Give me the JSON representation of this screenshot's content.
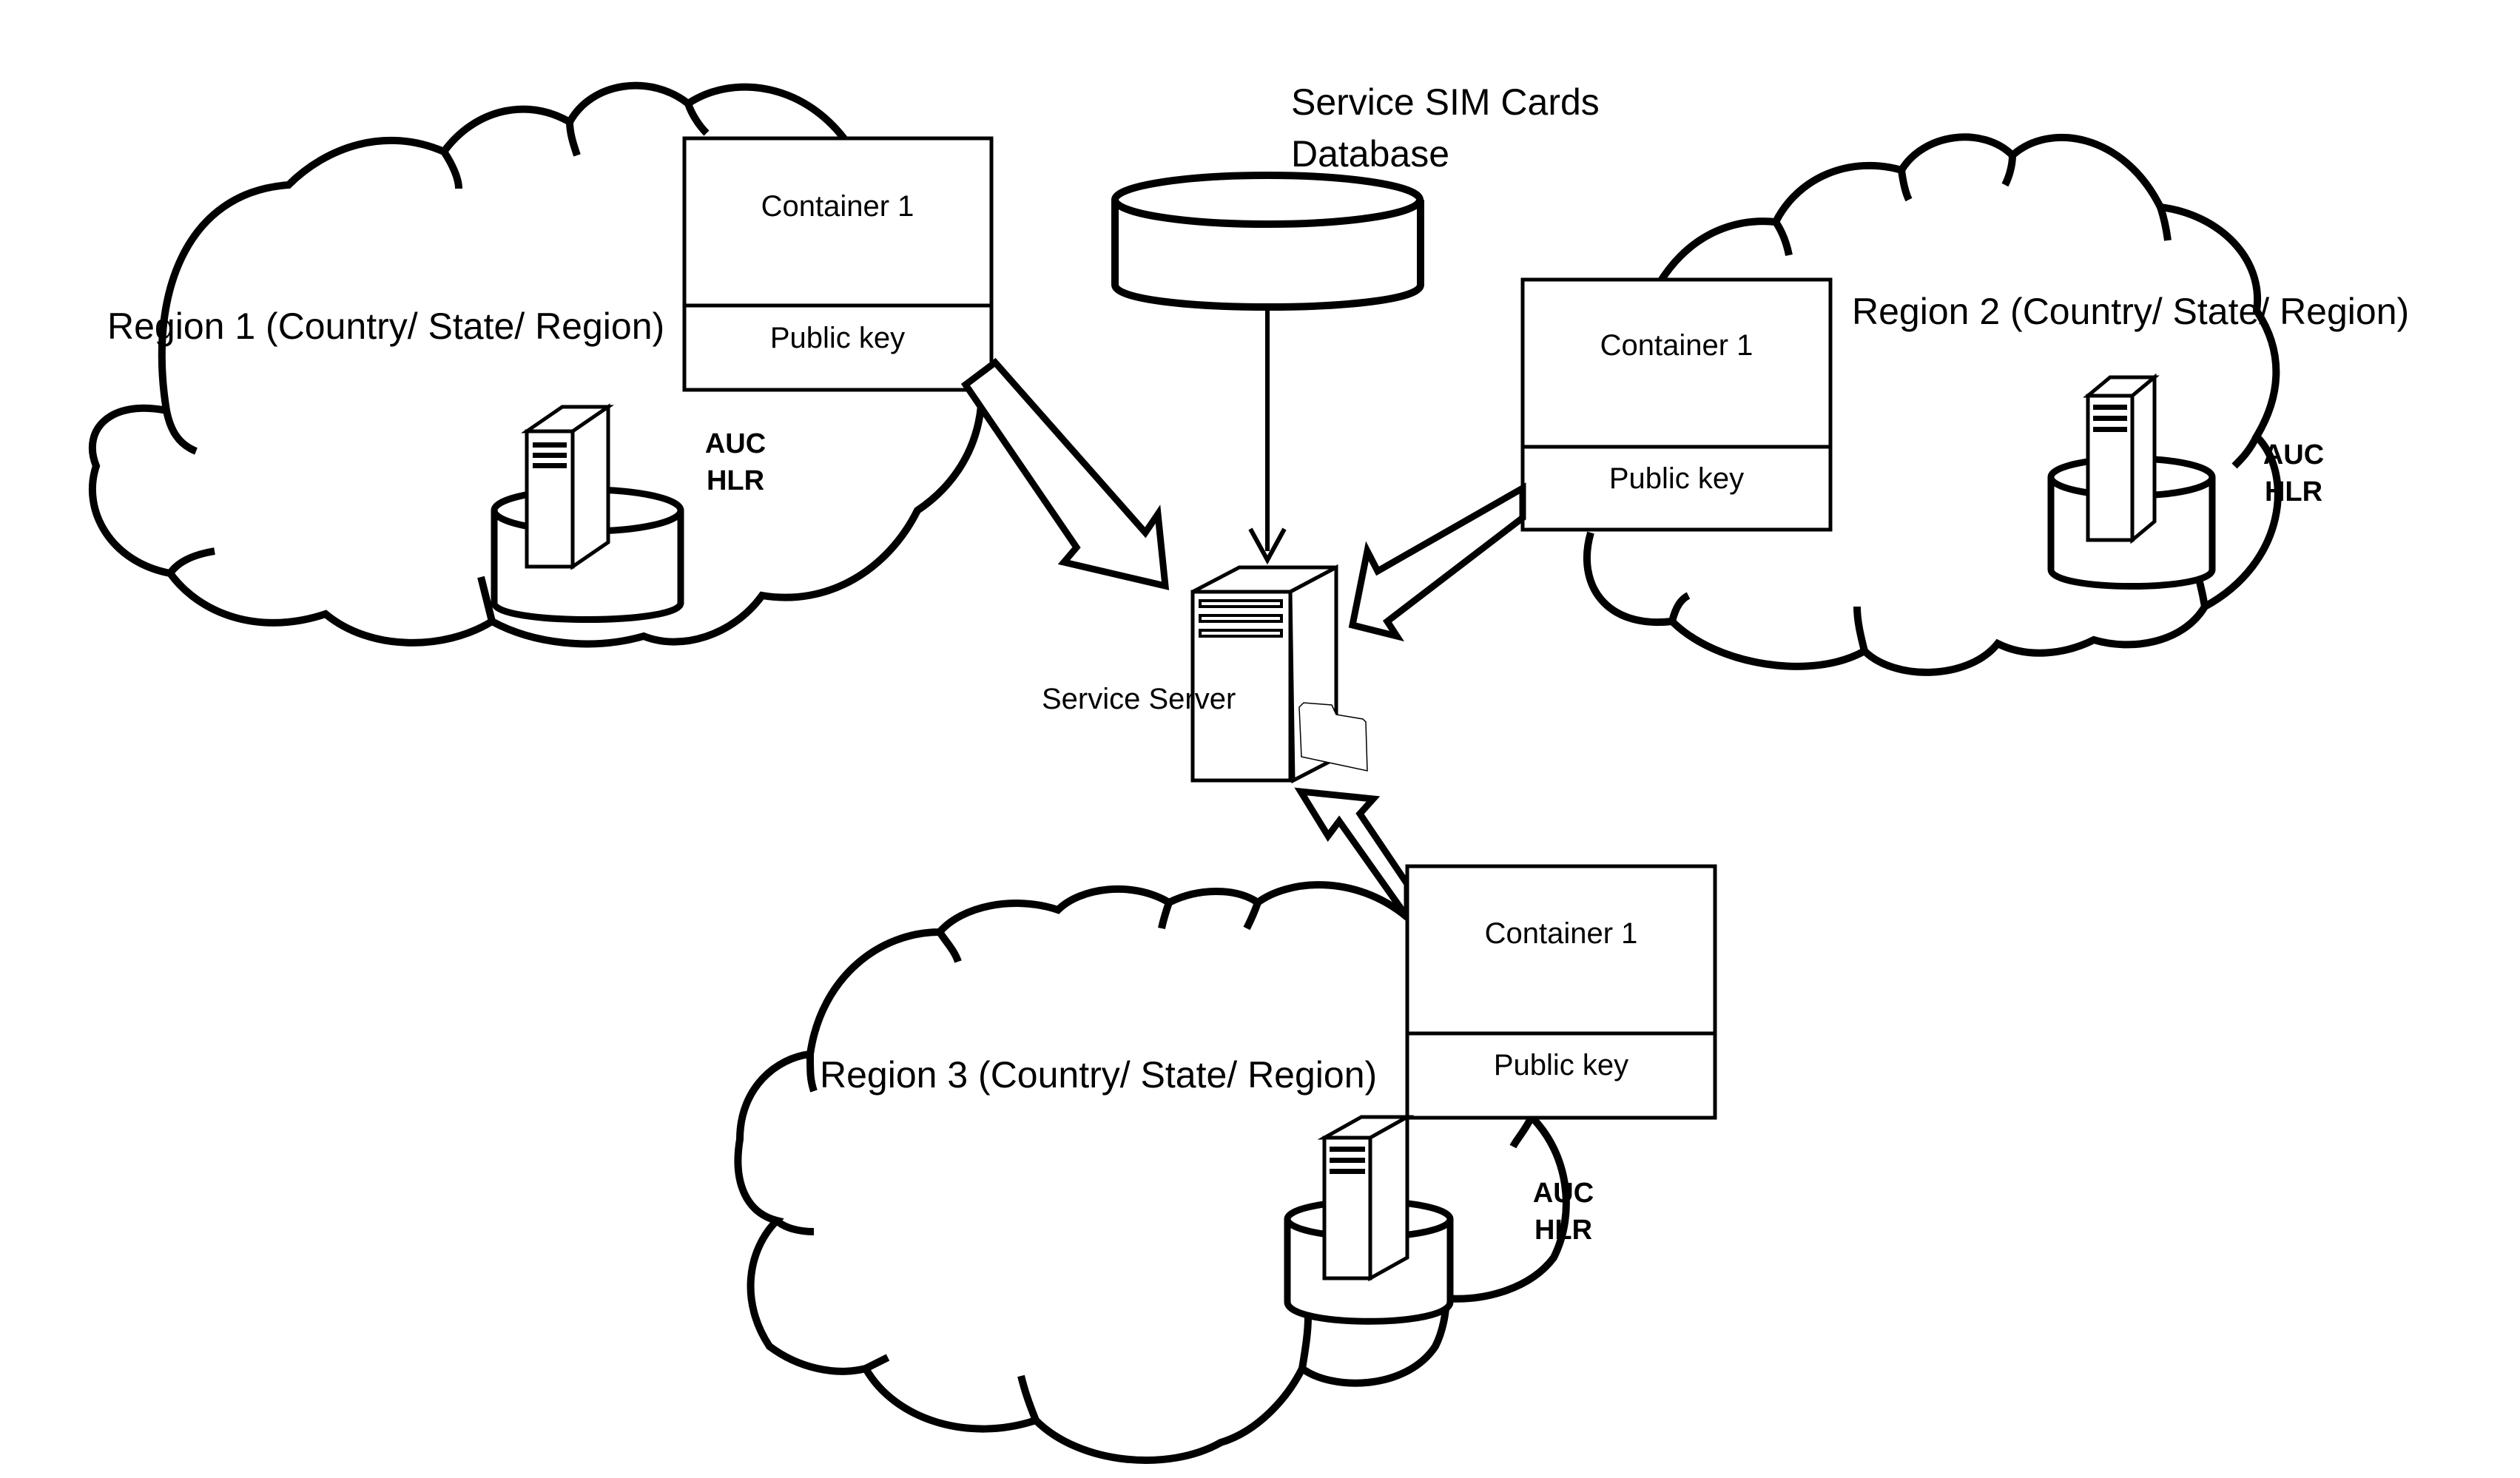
{
  "diagram": {
    "database": {
      "label_line1": "Service SIM Cards",
      "label_line2": "Database"
    },
    "server": {
      "label": "Service Server"
    },
    "regions": [
      {
        "label": "Region 1 (Country/ State/ Region)",
        "container": {
          "title": "Container 1",
          "key": "Public key"
        },
        "auth": {
          "line1": "AUC",
          "line2": "HLR"
        }
      },
      {
        "label": "Region 2 (Country/ State/ Region)",
        "container": {
          "title": "Container 1",
          "key": "Public key"
        },
        "auth": {
          "line1": "AUC",
          "line2": "HLR"
        }
      },
      {
        "label": "Region 3 (Country/ State/ Region)",
        "container": {
          "title": "Container 1",
          "key": "Public key"
        },
        "auth": {
          "line1": "AUC",
          "line2": "HLR"
        }
      }
    ],
    "colors": {
      "stroke": "#000000",
      "background": "#ffffff"
    }
  }
}
